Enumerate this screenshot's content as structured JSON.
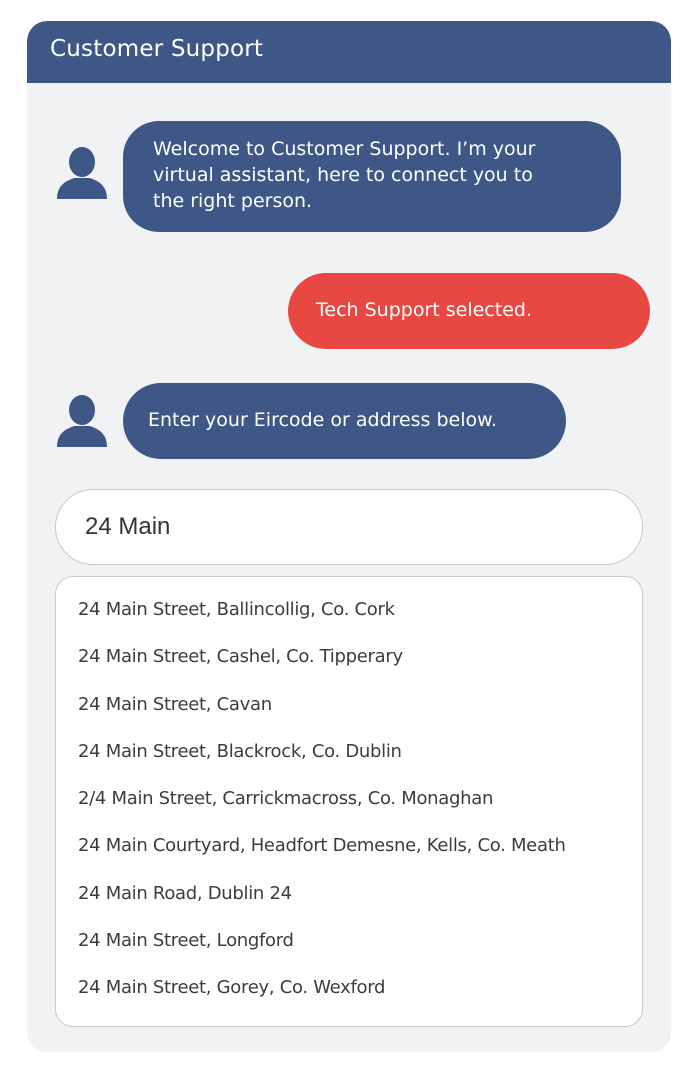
{
  "header": {
    "title": "Customer Support"
  },
  "messages": [
    {
      "sender": "bot",
      "icon": "user-avatar-icon",
      "lines": [
        "Welcome to Customer Support. I’m your",
        "virtual assistant, here to connect you to",
        "the right person."
      ]
    },
    {
      "sender": "user",
      "text": "Tech Support selected."
    },
    {
      "sender": "bot",
      "icon": "user-avatar-icon",
      "text": "Enter your Eircode or address below."
    }
  ],
  "address_input": {
    "value": "24 Main"
  },
  "suggestions": [
    "24 Main Street, Ballincollig, Co. Cork",
    "24 Main Street, Cashel, Co. Tipperary",
    "24 Main Street, Cavan",
    "24 Main Street, Blackrock, Co. Dublin",
    "2/4 Main Street, Carrickmacross, Co. Monaghan",
    "24 Main Courtyard, Headfort Demesne, Kells, Co. Meath",
    "24 Main Road, Dublin 24",
    "24 Main Street, Longford",
    "24 Main Street, Gorey, Co. Wexford"
  ],
  "colors": {
    "header": "#3e5786",
    "bot_bubble": "#3e5786",
    "user_bubble": "#e84842",
    "panel_background": "#f1f2f4"
  }
}
